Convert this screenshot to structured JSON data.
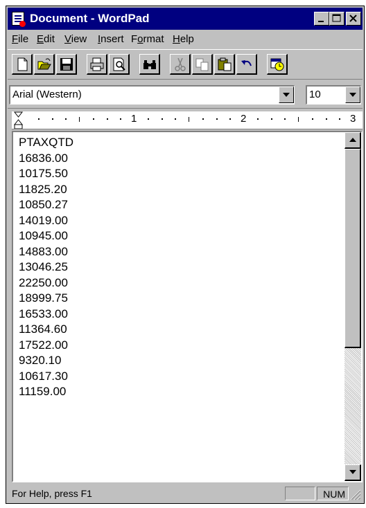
{
  "window": {
    "title": "Document - WordPad",
    "icons": {
      "app": "wordpad-icon",
      "minimize": "minimize-icon",
      "maximize": "maximize-icon",
      "close": "close-icon"
    }
  },
  "menubar": {
    "items": [
      {
        "label": "File",
        "accel": "F",
        "rest": "ile"
      },
      {
        "label": "Edit",
        "accel": "E",
        "rest": "dit"
      },
      {
        "label": "View",
        "accel": "V",
        "rest": "iew"
      },
      {
        "label": "Insert",
        "accel": "I",
        "rest": "nsert"
      },
      {
        "label": "Format",
        "pre": "F",
        "accel": "o",
        "rest": "rmat"
      },
      {
        "label": "Help",
        "accel": "H",
        "rest": "elp"
      }
    ]
  },
  "toolbar": {
    "buttons": [
      "new-icon",
      "open-icon",
      "save-icon",
      "print-icon",
      "print-preview-icon",
      "find-icon",
      "cut-icon",
      "copy-icon",
      "paste-icon",
      "undo-icon",
      "date-time-icon"
    ]
  },
  "format_bar": {
    "font": "Arial (Western)",
    "size": "10"
  },
  "ruler": {
    "labels": [
      "1",
      "2",
      "3"
    ]
  },
  "document": {
    "lines": [
      "PTAXQTD",
      "16836.00",
      "10175.50",
      "11825.20",
      "10850.27",
      "14019.00",
      "10945.00",
      "14883.00",
      "13046.25",
      "22250.00",
      "18999.75",
      "16533.00",
      "11364.60",
      "17522.00",
      "9320.10",
      "10617.30",
      "11159.00"
    ]
  },
  "statusbar": {
    "help_text": "For Help, press F1",
    "num": "NUM"
  },
  "colors": {
    "titlebar": "#000080",
    "face": "#c0c0c0"
  }
}
